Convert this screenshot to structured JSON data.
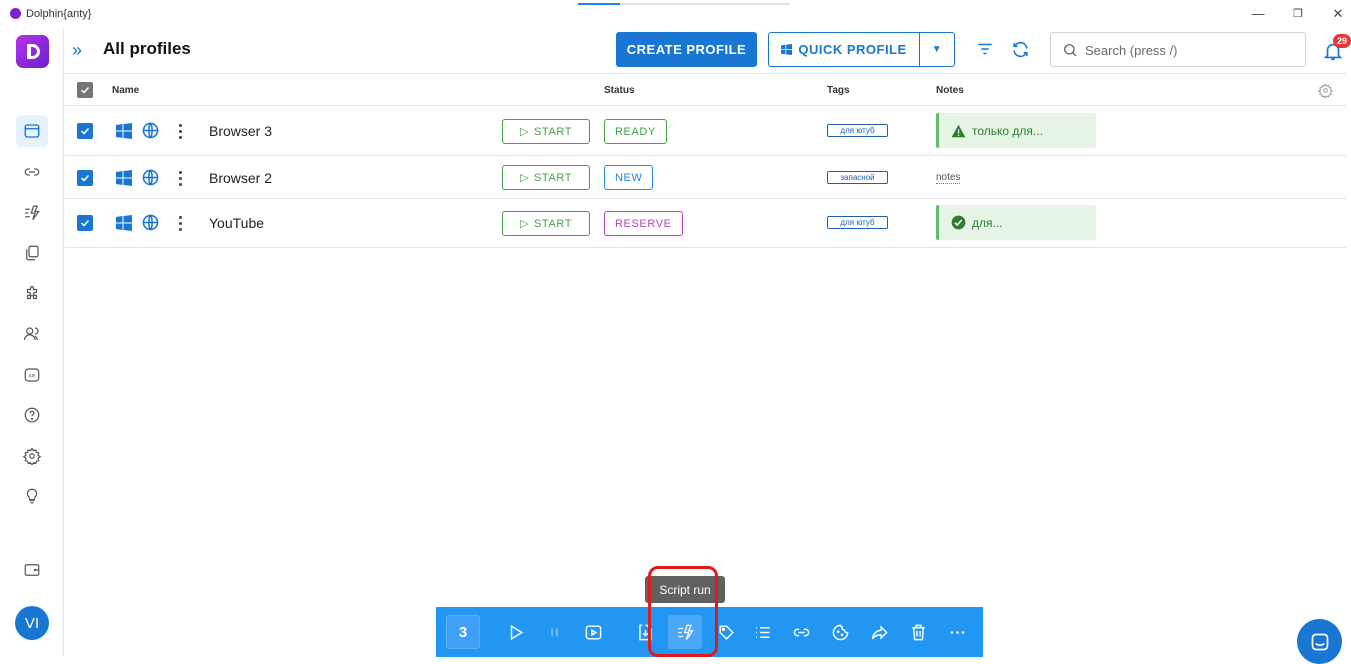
{
  "app": {
    "title": "Dolphin{anty}"
  },
  "window": {
    "minimize": "—",
    "maximize": "❐",
    "close": "✕"
  },
  "header": {
    "title": "All profiles",
    "create_label": "CREATE PROFILE",
    "quick_label": "QUICK PROFILE",
    "search_placeholder": "Search (press /)",
    "notifications_count": "29"
  },
  "sidebar": {
    "items": [
      {
        "id": "profiles",
        "icon": "browser-window-icon",
        "active": true
      },
      {
        "id": "proxies",
        "icon": "link-icon"
      },
      {
        "id": "scenarios",
        "icon": "script-run-icon"
      },
      {
        "id": "bookmarks",
        "icon": "copy-icon"
      },
      {
        "id": "extensions",
        "icon": "puzzle-icon"
      },
      {
        "id": "users",
        "icon": "users-icon"
      },
      {
        "id": "api",
        "icon": "api-icon"
      },
      {
        "id": "help",
        "icon": "help-icon"
      },
      {
        "id": "settings",
        "icon": "gear-icon"
      },
      {
        "id": "tips",
        "icon": "lightbulb-icon"
      },
      {
        "id": "wallet",
        "icon": "wallet-icon"
      }
    ],
    "avatar": "VI"
  },
  "table": {
    "columns": {
      "name": "Name",
      "status": "Status",
      "tags": "Tags",
      "notes": "Notes"
    },
    "start_label": "START",
    "rows": [
      {
        "name": "Browser 3",
        "status": "READY",
        "status_color": "#43a047",
        "tag": "для ютуб",
        "note": "только для...",
        "note_type": "warning"
      },
      {
        "name": "Browser 2",
        "status": "NEW",
        "status_color": "#1e88e5",
        "tag": "запасной",
        "note": "notes",
        "note_type": "plain"
      },
      {
        "name": "YouTube",
        "status": "RESERVE",
        "status_color": "#ab47bc",
        "tag": "для ютуб",
        "note": "для...",
        "note_type": "success"
      }
    ]
  },
  "bulkbar": {
    "selected_count": "3",
    "tooltip": "Script run"
  },
  "colors": {
    "accent": "#1976d2",
    "bulkbar": "#2196f3",
    "highlight": "#e0191a"
  }
}
